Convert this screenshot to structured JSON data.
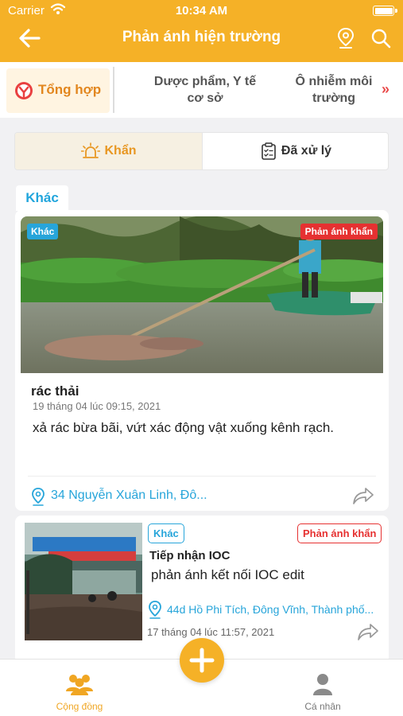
{
  "status_bar": {
    "carrier": "Carrier",
    "time": "10:34 AM"
  },
  "header": {
    "title": "Phản ánh hiện trường"
  },
  "categories": {
    "active": "Tổng hợp",
    "items": [
      {
        "line1": "Dược phẩm, Y tế",
        "line2": "cơ sở"
      },
      {
        "line1": "Ô nhiễm môi",
        "line2": "trường"
      }
    ],
    "more": "»"
  },
  "segment": {
    "urgent": "Khẩn",
    "processed": "Đã xử lý"
  },
  "section": {
    "label": "Khác"
  },
  "posts": [
    {
      "category": "Khác",
      "priority": "Phản ánh khẩn",
      "title": "rác thải",
      "time": "19 tháng 04 lúc 09:15, 2021",
      "description": "xả rác bừa bãi, vứt xác động vật xuống kênh rạch.",
      "address": "34 Nguyễn Xuân Linh, Đô..."
    },
    {
      "category": "Khác",
      "priority": "Phản ánh khẩn",
      "title": "Tiếp nhận IOC",
      "description": "phản ánh kết nối IOC edit",
      "address": "44d Hồ Phi Tích, Đông Vĩnh, Thành phố...",
      "time": "17 tháng 04 lúc 11:57, 2021"
    }
  ],
  "tabbar": {
    "community": "Cộng đồng",
    "personal": "Cá nhân"
  },
  "colors": {
    "primary": "#f5b127",
    "accent_blue": "#27a5da",
    "urgent_red": "#e63131",
    "active_orange": "#e2861e"
  },
  "icons": [
    "back-arrow-icon",
    "map-pin-icon",
    "search-icon",
    "siren-icon",
    "clipboard-icon",
    "location-icon",
    "share-icon",
    "plus-icon",
    "community-icon",
    "person-icon"
  ]
}
